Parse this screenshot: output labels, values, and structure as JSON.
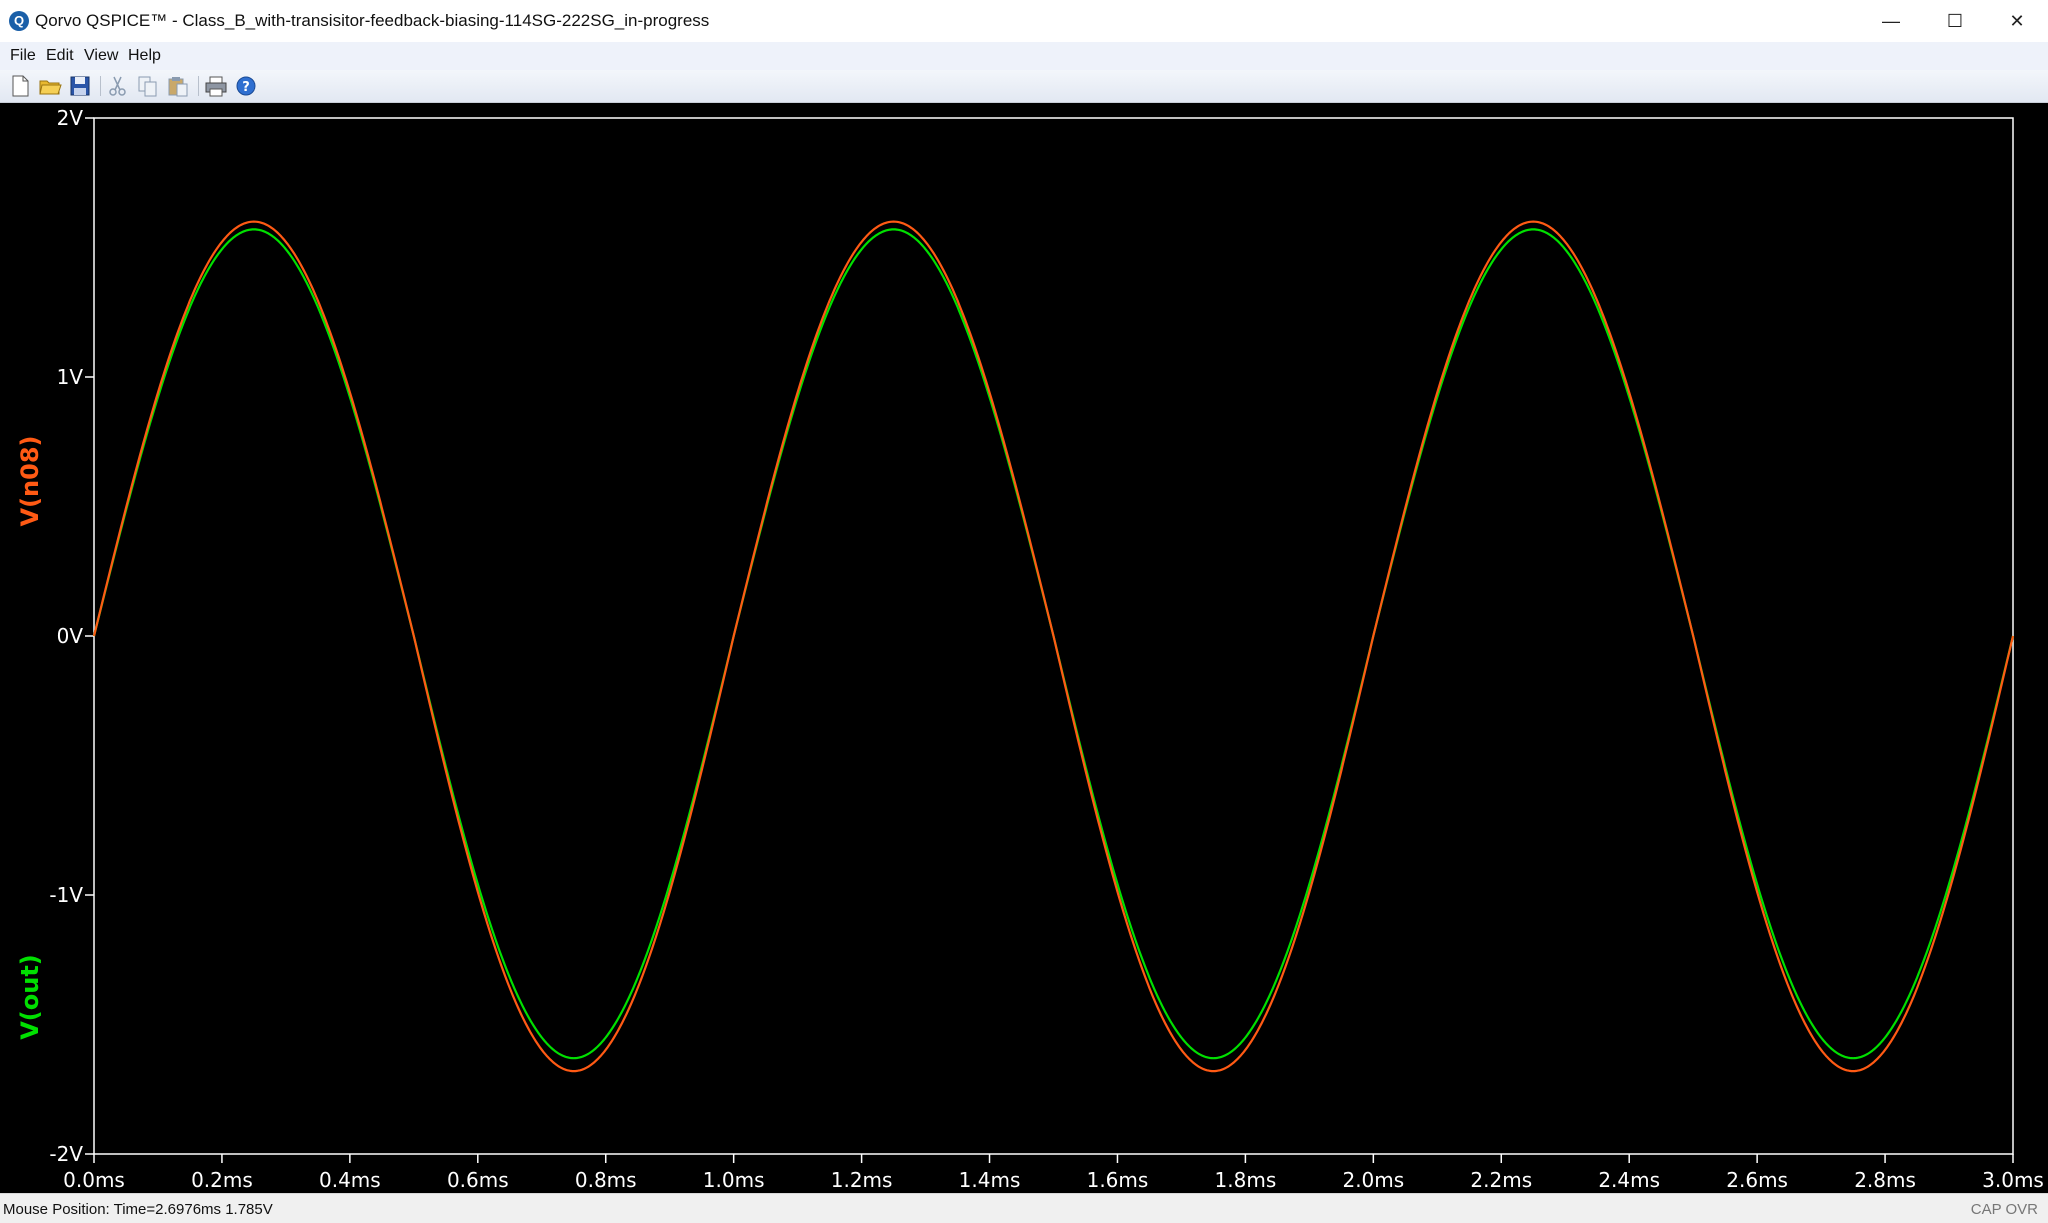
{
  "window": {
    "title": "Qorvo QSPICE™ - Class_B_with-transisitor-feedback-biasing-114SG-222SG_in-progress",
    "app_icon_letter": "Q",
    "minimize_glyph": "—",
    "maximize_glyph": "☐",
    "close_glyph": "✕"
  },
  "menu": {
    "items": [
      {
        "label": "File"
      },
      {
        "label": "Edit"
      },
      {
        "label": "View"
      },
      {
        "label": "Help"
      }
    ]
  },
  "toolbar": {
    "buttons": [
      {
        "name": "new-document-icon"
      },
      {
        "name": "open-folder-icon"
      },
      {
        "name": "save-icon"
      },
      {
        "name": "cut-icon"
      },
      {
        "name": "copy-icon"
      },
      {
        "name": "paste-icon"
      },
      {
        "name": "print-icon"
      },
      {
        "name": "help-icon"
      }
    ]
  },
  "chart_data": {
    "type": "line",
    "background": "#000000",
    "axis_color": "#ffffff",
    "xlim": [
      0,
      3.0
    ],
    "ylim": [
      -2,
      2
    ],
    "x_unit": "ms",
    "x_ticks": [
      0,
      0.2,
      0.4,
      0.6,
      0.8,
      1.0,
      1.2,
      1.4,
      1.6,
      1.8,
      2.0,
      2.2,
      2.4,
      2.6,
      2.8,
      3.0
    ],
    "x_tick_labels": [
      "0.0ms",
      "0.2ms",
      "0.4ms",
      "0.6ms",
      "0.8ms",
      "1.0ms",
      "1.2ms",
      "1.4ms",
      "1.6ms",
      "1.8ms",
      "2.0ms",
      "2.2ms",
      "2.4ms",
      "2.6ms",
      "2.8ms",
      "3.0ms"
    ],
    "y_ticks": [
      2,
      1,
      0,
      -1,
      -2
    ],
    "y_tick_labels": [
      "2V",
      "1V",
      "0V",
      "-1V",
      "-2V"
    ],
    "grid": false,
    "series": [
      {
        "name": "V(n08)",
        "color": "#ff5a14",
        "shape": "sine",
        "frequency_khz": 1.0,
        "peak_positive": 1.6,
        "peak_negative": -1.68,
        "x": [
          0,
          0.125,
          0.25,
          0.375,
          0.5,
          0.625,
          0.75,
          0.875,
          1.0,
          1.125,
          1.25,
          1.375,
          1.5,
          1.625,
          1.75,
          1.875,
          2.0,
          2.125,
          2.25,
          2.375,
          2.5,
          2.625,
          2.75,
          2.875,
          3.0
        ],
        "y": [
          0,
          1.13,
          1.6,
          1.13,
          0,
          -1.19,
          -1.68,
          -1.19,
          0,
          1.13,
          1.6,
          1.13,
          0,
          -1.19,
          -1.68,
          -1.19,
          0,
          1.13,
          1.6,
          1.13,
          0,
          -1.19,
          -1.68,
          -1.19,
          0
        ]
      },
      {
        "name": "V(out)",
        "color": "#00e000",
        "shape": "sine",
        "frequency_khz": 1.0,
        "peak_positive": 1.57,
        "peak_negative": -1.63,
        "x": [
          0,
          0.125,
          0.25,
          0.375,
          0.5,
          0.625,
          0.75,
          0.875,
          1.0,
          1.125,
          1.25,
          1.375,
          1.5,
          1.625,
          1.75,
          1.875,
          2.0,
          2.125,
          2.25,
          2.375,
          2.5,
          2.625,
          2.75,
          2.875,
          3.0
        ],
        "y": [
          0,
          1.11,
          1.57,
          1.11,
          0,
          -1.15,
          -1.63,
          -1.15,
          0,
          1.11,
          1.57,
          1.11,
          0,
          -1.15,
          -1.63,
          -1.15,
          0,
          1.11,
          1.57,
          1.11,
          0,
          -1.15,
          -1.63,
          -1.15,
          0
        ]
      }
    ]
  },
  "status": {
    "mouse_position": "Mouse Position: Time=2.6976ms  1.785V",
    "indicators": "CAP OVR"
  }
}
